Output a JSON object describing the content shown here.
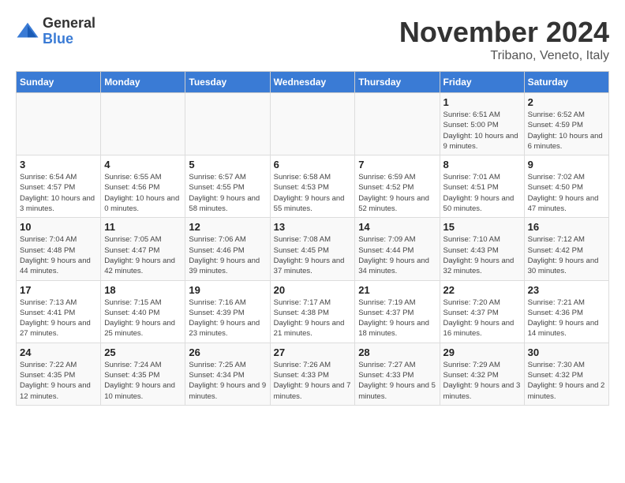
{
  "header": {
    "logo_general": "General",
    "logo_blue": "Blue",
    "month_title": "November 2024",
    "subtitle": "Tribano, Veneto, Italy"
  },
  "weekdays": [
    "Sunday",
    "Monday",
    "Tuesday",
    "Wednesday",
    "Thursday",
    "Friday",
    "Saturday"
  ],
  "weeks": [
    [
      {
        "day": "",
        "info": ""
      },
      {
        "day": "",
        "info": ""
      },
      {
        "day": "",
        "info": ""
      },
      {
        "day": "",
        "info": ""
      },
      {
        "day": "",
        "info": ""
      },
      {
        "day": "1",
        "info": "Sunrise: 6:51 AM\nSunset: 5:00 PM\nDaylight: 10 hours and 9 minutes."
      },
      {
        "day": "2",
        "info": "Sunrise: 6:52 AM\nSunset: 4:59 PM\nDaylight: 10 hours and 6 minutes."
      }
    ],
    [
      {
        "day": "3",
        "info": "Sunrise: 6:54 AM\nSunset: 4:57 PM\nDaylight: 10 hours and 3 minutes."
      },
      {
        "day": "4",
        "info": "Sunrise: 6:55 AM\nSunset: 4:56 PM\nDaylight: 10 hours and 0 minutes."
      },
      {
        "day": "5",
        "info": "Sunrise: 6:57 AM\nSunset: 4:55 PM\nDaylight: 9 hours and 58 minutes."
      },
      {
        "day": "6",
        "info": "Sunrise: 6:58 AM\nSunset: 4:53 PM\nDaylight: 9 hours and 55 minutes."
      },
      {
        "day": "7",
        "info": "Sunrise: 6:59 AM\nSunset: 4:52 PM\nDaylight: 9 hours and 52 minutes."
      },
      {
        "day": "8",
        "info": "Sunrise: 7:01 AM\nSunset: 4:51 PM\nDaylight: 9 hours and 50 minutes."
      },
      {
        "day": "9",
        "info": "Sunrise: 7:02 AM\nSunset: 4:50 PM\nDaylight: 9 hours and 47 minutes."
      }
    ],
    [
      {
        "day": "10",
        "info": "Sunrise: 7:04 AM\nSunset: 4:48 PM\nDaylight: 9 hours and 44 minutes."
      },
      {
        "day": "11",
        "info": "Sunrise: 7:05 AM\nSunset: 4:47 PM\nDaylight: 9 hours and 42 minutes."
      },
      {
        "day": "12",
        "info": "Sunrise: 7:06 AM\nSunset: 4:46 PM\nDaylight: 9 hours and 39 minutes."
      },
      {
        "day": "13",
        "info": "Sunrise: 7:08 AM\nSunset: 4:45 PM\nDaylight: 9 hours and 37 minutes."
      },
      {
        "day": "14",
        "info": "Sunrise: 7:09 AM\nSunset: 4:44 PM\nDaylight: 9 hours and 34 minutes."
      },
      {
        "day": "15",
        "info": "Sunrise: 7:10 AM\nSunset: 4:43 PM\nDaylight: 9 hours and 32 minutes."
      },
      {
        "day": "16",
        "info": "Sunrise: 7:12 AM\nSunset: 4:42 PM\nDaylight: 9 hours and 30 minutes."
      }
    ],
    [
      {
        "day": "17",
        "info": "Sunrise: 7:13 AM\nSunset: 4:41 PM\nDaylight: 9 hours and 27 minutes."
      },
      {
        "day": "18",
        "info": "Sunrise: 7:15 AM\nSunset: 4:40 PM\nDaylight: 9 hours and 25 minutes."
      },
      {
        "day": "19",
        "info": "Sunrise: 7:16 AM\nSunset: 4:39 PM\nDaylight: 9 hours and 23 minutes."
      },
      {
        "day": "20",
        "info": "Sunrise: 7:17 AM\nSunset: 4:38 PM\nDaylight: 9 hours and 21 minutes."
      },
      {
        "day": "21",
        "info": "Sunrise: 7:19 AM\nSunset: 4:37 PM\nDaylight: 9 hours and 18 minutes."
      },
      {
        "day": "22",
        "info": "Sunrise: 7:20 AM\nSunset: 4:37 PM\nDaylight: 9 hours and 16 minutes."
      },
      {
        "day": "23",
        "info": "Sunrise: 7:21 AM\nSunset: 4:36 PM\nDaylight: 9 hours and 14 minutes."
      }
    ],
    [
      {
        "day": "24",
        "info": "Sunrise: 7:22 AM\nSunset: 4:35 PM\nDaylight: 9 hours and 12 minutes."
      },
      {
        "day": "25",
        "info": "Sunrise: 7:24 AM\nSunset: 4:35 PM\nDaylight: 9 hours and 10 minutes."
      },
      {
        "day": "26",
        "info": "Sunrise: 7:25 AM\nSunset: 4:34 PM\nDaylight: 9 hours and 9 minutes."
      },
      {
        "day": "27",
        "info": "Sunrise: 7:26 AM\nSunset: 4:33 PM\nDaylight: 9 hours and 7 minutes."
      },
      {
        "day": "28",
        "info": "Sunrise: 7:27 AM\nSunset: 4:33 PM\nDaylight: 9 hours and 5 minutes."
      },
      {
        "day": "29",
        "info": "Sunrise: 7:29 AM\nSunset: 4:32 PM\nDaylight: 9 hours and 3 minutes."
      },
      {
        "day": "30",
        "info": "Sunrise: 7:30 AM\nSunset: 4:32 PM\nDaylight: 9 hours and 2 minutes."
      }
    ]
  ]
}
